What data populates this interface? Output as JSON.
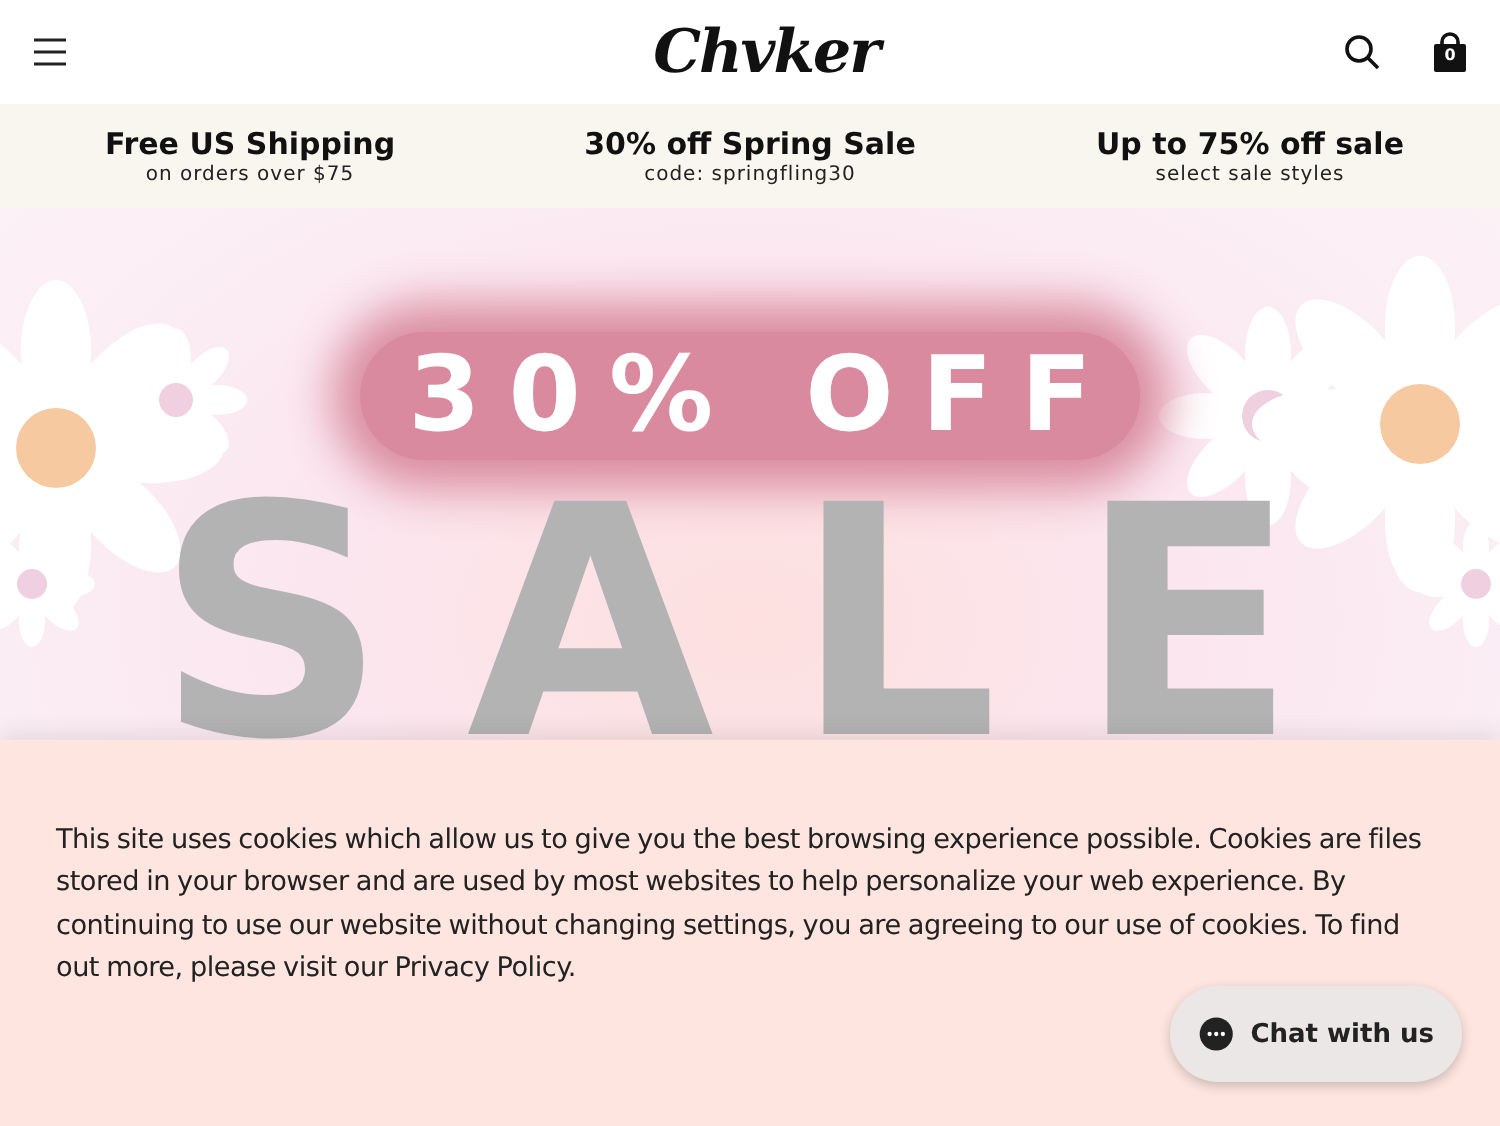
{
  "header": {
    "logo": "Chvker",
    "cart_count": "0"
  },
  "promos": [
    {
      "title": "Free US Shipping",
      "subtitle": "on orders over $75"
    },
    {
      "title": "30% off Spring Sale",
      "subtitle": "code: springfling30"
    },
    {
      "title": "Up to 75% off sale",
      "subtitle": "select sale styles"
    }
  ],
  "hero": {
    "headline": "30% OFF",
    "word": "SALE"
  },
  "cookie_banner": {
    "text": "This site uses cookies which allow us to give you the best browsing experience possible. Cookies are files stored in your browser and are used by most websites to help personalize your web experience. By continuing to use our website without changing settings, you are agreeing to our use of cookies. To find out more, please visit our Privacy Policy."
  },
  "chat": {
    "label": "Chat with us"
  }
}
